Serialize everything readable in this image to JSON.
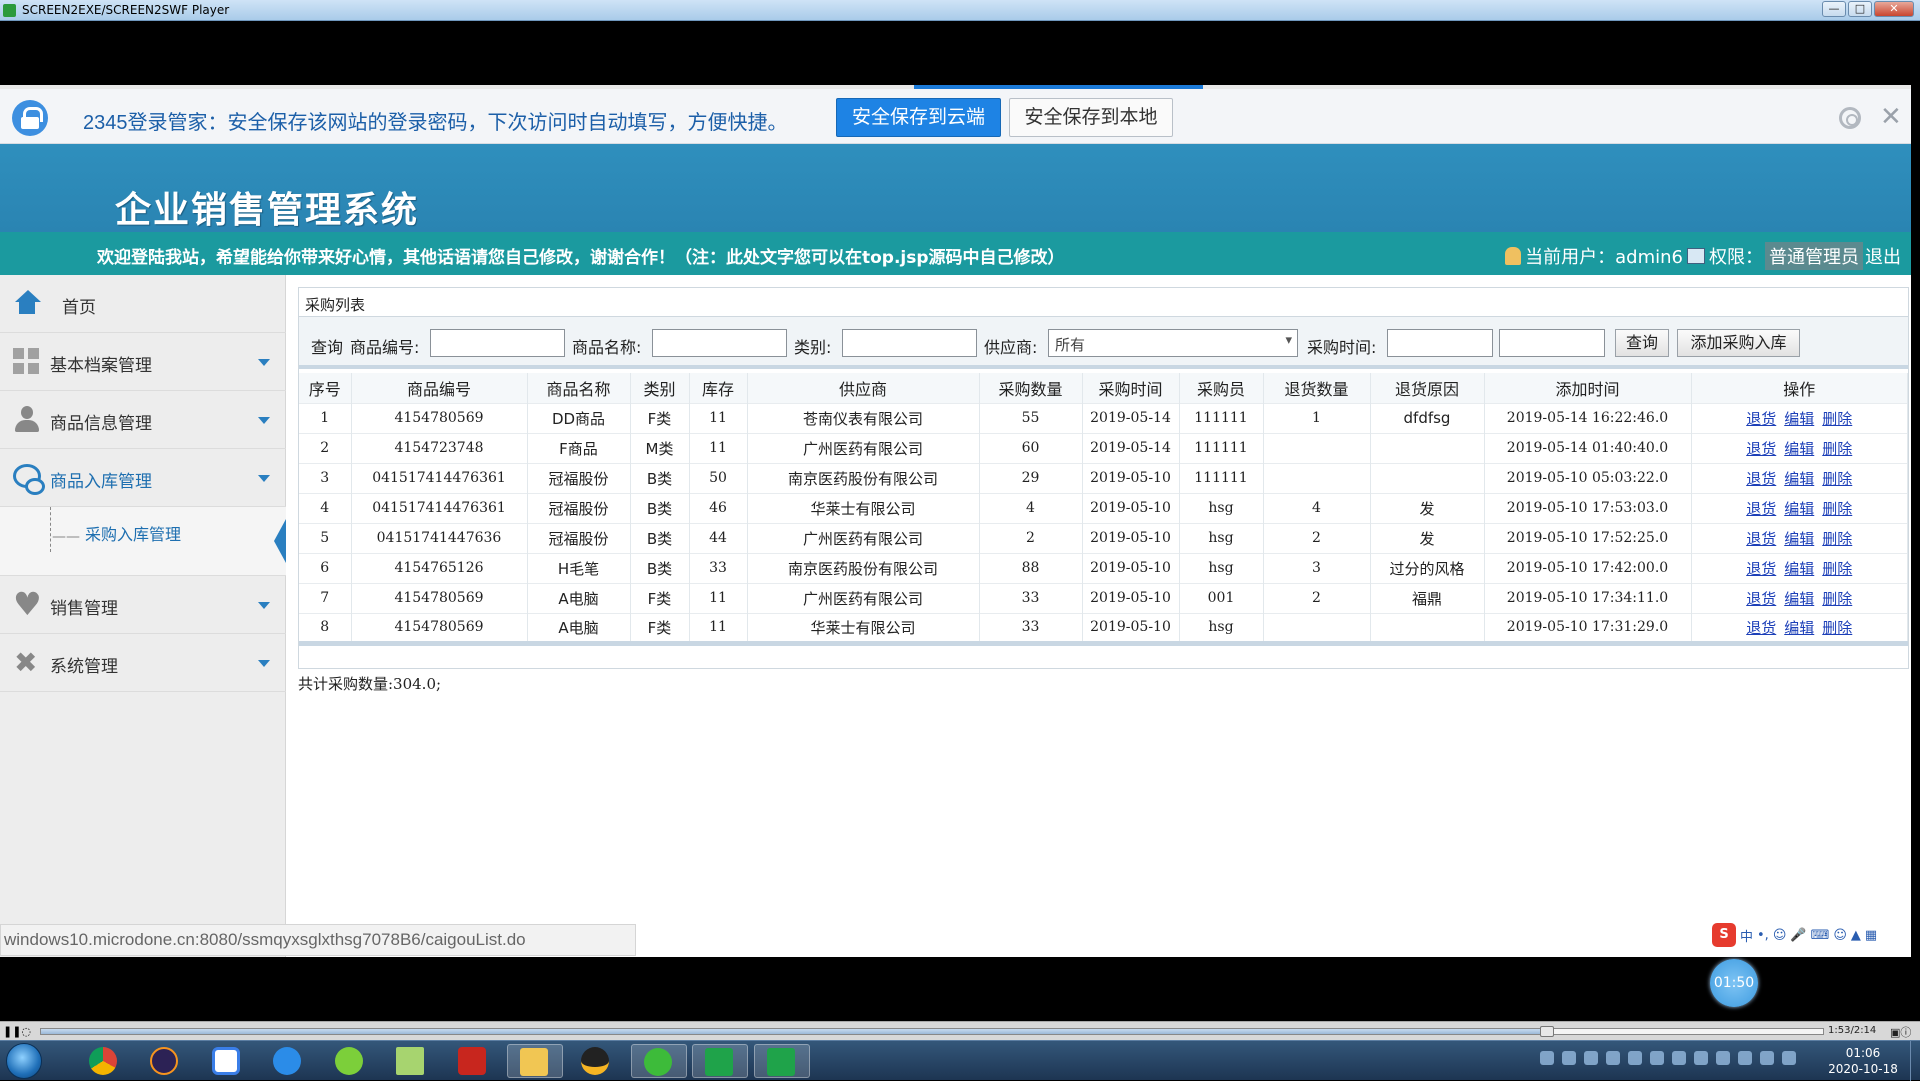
{
  "player": {
    "title": "SCREEN2EXE/SCREEN2SWF Player",
    "controls": {
      "time": "1:53/2:14",
      "progress_fraction": 0.845
    }
  },
  "pw_bar": {
    "message": "2345登录管家：安全保存该网站的登录密码，下次访问时自动填写，方便快捷。",
    "btn_cloud": "安全保存到云端",
    "btn_local": "安全保存到本地"
  },
  "app": {
    "title": "企业销售管理系统",
    "welcome": "欢迎登陆我站，希望能给你带来好心情，其他话语请您自己修改，谢谢合作！（注：此处文字您可以在top.jsp源码中自己修改）",
    "user_label": "当前用户：admin6",
    "role_label": "权限：",
    "role_value": "普通管理员",
    "logout": "退出"
  },
  "sidebar": {
    "home": "首页",
    "items": [
      "基本档案管理",
      "商品信息管理",
      "商品入库管理",
      "销售管理",
      "系统管理"
    ],
    "sub_item": "采购入库管理"
  },
  "panel": {
    "title": "采购列表",
    "search": {
      "query_label": "查询",
      "code_label": "商品编号:",
      "name_label": "商品名称:",
      "category_label": "类别:",
      "supplier_label": "供应商:",
      "supplier_value": "所有",
      "time_label": "采购时间:",
      "query_btn": "查询",
      "add_btn": "添加采购入库"
    },
    "columns": [
      "序号",
      "商品编号",
      "商品名称",
      "类别",
      "库存",
      "供应商",
      "采购数量",
      "采购时间",
      "采购员",
      "退货数量",
      "退货原因",
      "添加时间",
      "操作"
    ],
    "rows": [
      [
        "1",
        "4154780569",
        "DD商品",
        "F类",
        "11",
        "苍南仪表有限公司",
        "55",
        "2019-05-14",
        "111111",
        "1",
        "dfdfsg",
        "2019-05-14 16:22:46.0"
      ],
      [
        "2",
        "4154723748",
        "F商品",
        "M类",
        "11",
        "广州医药有限公司",
        "60",
        "2019-05-14",
        "111111",
        "",
        "",
        "2019-05-14 01:40:40.0"
      ],
      [
        "3",
        "041517414476361",
        "冠福股份",
        "B类",
        "50",
        "南京医药股份有限公司",
        "29",
        "2019-05-10",
        "111111",
        "",
        "",
        "2019-05-10 05:03:22.0"
      ],
      [
        "4",
        "041517414476361",
        "冠福股份",
        "B类",
        "46",
        "华莱士有限公司",
        "4",
        "2019-05-10",
        "hsg",
        "4",
        "发",
        "2019-05-10 17:53:03.0"
      ],
      [
        "5",
        "04151741447636",
        "冠福股份",
        "B类",
        "44",
        "广州医药有限公司",
        "2",
        "2019-05-10",
        "hsg",
        "2",
        "发",
        "2019-05-10 17:52:25.0"
      ],
      [
        "6",
        "4154765126",
        "H毛笔",
        "B类",
        "33",
        "南京医药股份有限公司",
        "88",
        "2019-05-10",
        "hsg",
        "3",
        "过分的风格",
        "2019-05-10 17:42:00.0"
      ],
      [
        "7",
        "4154780569",
        "A电脑",
        "F类",
        "11",
        "广州医药有限公司",
        "33",
        "2019-05-10",
        "001",
        "2",
        "福鼎",
        "2019-05-10 17:34:11.0"
      ],
      [
        "8",
        "4154780569",
        "A电脑",
        "F类",
        "11",
        "华莱士有限公司",
        "33",
        "2019-05-10",
        "hsg",
        "",
        "",
        "2019-05-10 17:31:29.0"
      ]
    ],
    "ops": [
      "退货",
      "编辑",
      "删除"
    ],
    "total": "共计采购数量:304.0;"
  },
  "status_url": "windows10.microdone.cn:8080/ssmqyxsglxthsg7078B6/caigouList.do",
  "widgets": {
    "timer": "01:50",
    "ime_label": "中"
  },
  "clock": {
    "time": "01:06",
    "date": "2020-10-18"
  }
}
